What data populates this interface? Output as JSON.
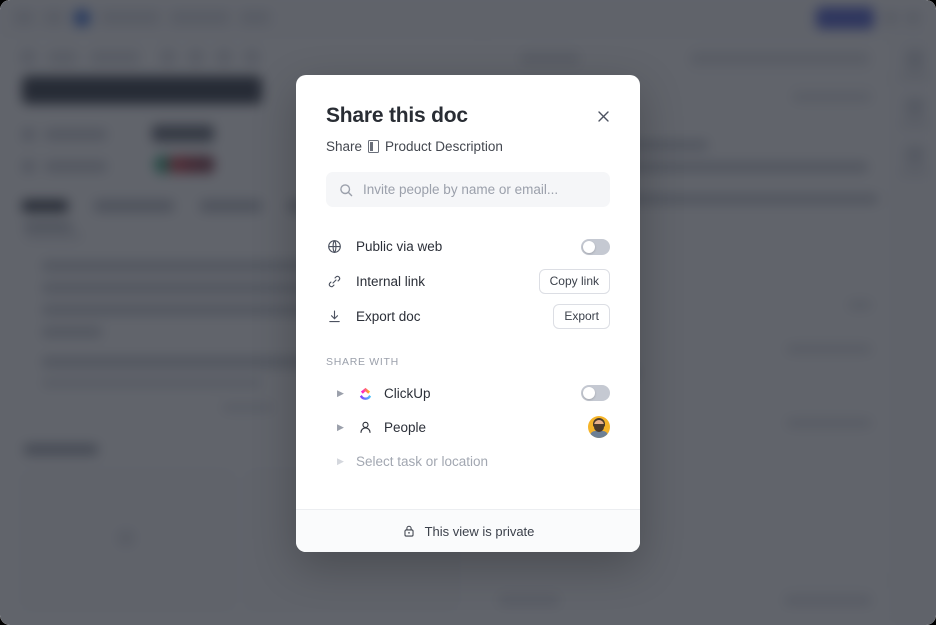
{
  "modal": {
    "title": "Share this doc",
    "close_icon": "close-icon",
    "breadcrumb": {
      "prefix": "Share",
      "doc_icon": "doc-icon",
      "doc_name": "Product Description"
    },
    "search": {
      "icon": "search-icon",
      "placeholder": "Invite people by name or email...",
      "value": ""
    },
    "options": [
      {
        "icon": "globe-icon",
        "label": "Public via web",
        "control": "toggle",
        "toggle_on": false
      },
      {
        "icon": "link-icon",
        "label": "Internal link",
        "control": "button",
        "button_label": "Copy link"
      },
      {
        "icon": "download-icon",
        "label": "Export doc",
        "control": "button",
        "button_label": "Export"
      }
    ],
    "share_with": {
      "section_label": "SHARE WITH",
      "rows": [
        {
          "caret": "caret-right-icon",
          "icon": "clickup-logo-icon",
          "label": "ClickUp",
          "control": "toggle",
          "toggle_on": false,
          "muted": false
        },
        {
          "caret": "caret-right-icon",
          "icon": "person-icon",
          "label": "People",
          "control": "avatar",
          "muted": false
        },
        {
          "caret": "caret-right-icon",
          "icon": "",
          "label": "Select task or location",
          "control": "none",
          "muted": true
        }
      ]
    },
    "footer": {
      "icon": "lock-icon",
      "text": "This view is private"
    }
  },
  "background": {
    "doc_title": "Task View Redesign",
    "tabs": [
      "Details",
      "Custom Fields",
      "Subtasks",
      "Docs"
    ],
    "fields": [
      "Status",
      "Assignees"
    ]
  },
  "colors": {
    "accent": "#4a5bd0",
    "scrim": "rgba(36,40,50,0.72)",
    "modal_bg": "#ffffff",
    "avatar_bg": "#f5b429",
    "toggle_off": "#c5c9d2"
  }
}
